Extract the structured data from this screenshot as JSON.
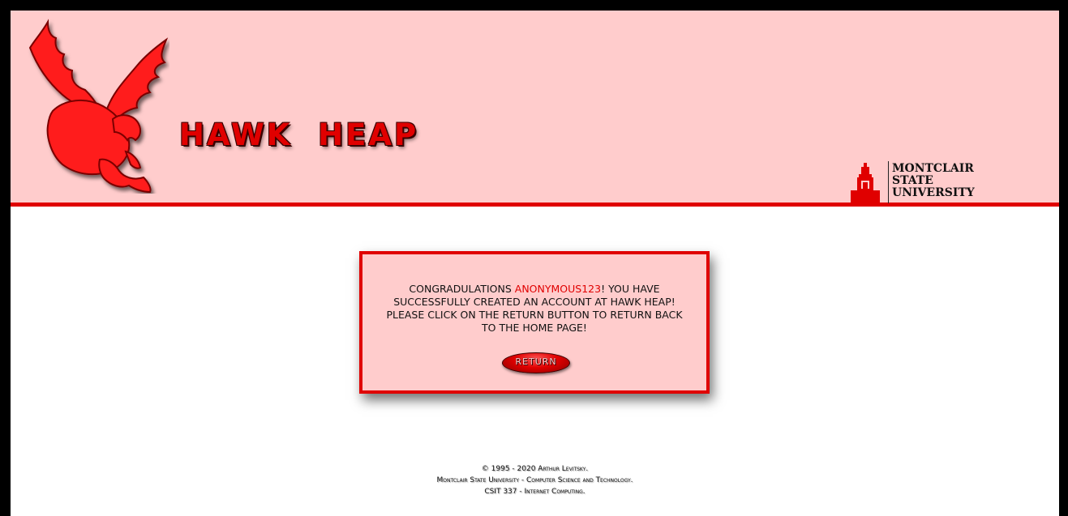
{
  "header": {
    "site_title": "HAWK  HEAP",
    "university_name": [
      "MONTCLAIR",
      "STATE",
      "UNIVERSITY"
    ],
    "logo_icon": "hawk-icon",
    "university_icon": "college-hall-tower-icon"
  },
  "dialog": {
    "message_before": "Congradulations ",
    "username": "anonymous123",
    "message_after": "! You have successfully created an account at Hawk Heap! Please click on the return button to return back to the home page!",
    "return_label": "RETURN"
  },
  "footer": {
    "line1": "© 1995 - 2020 Arthur Levitsky.",
    "line2": "Montclair State University - Computer Science and Technology.",
    "line3": "CSIT 337 - Internet Computing."
  },
  "colors": {
    "accent_red": "#e00000",
    "header_bg": "#ffcccc",
    "page_bg": "#ffffff",
    "frame_border": "#000000"
  }
}
